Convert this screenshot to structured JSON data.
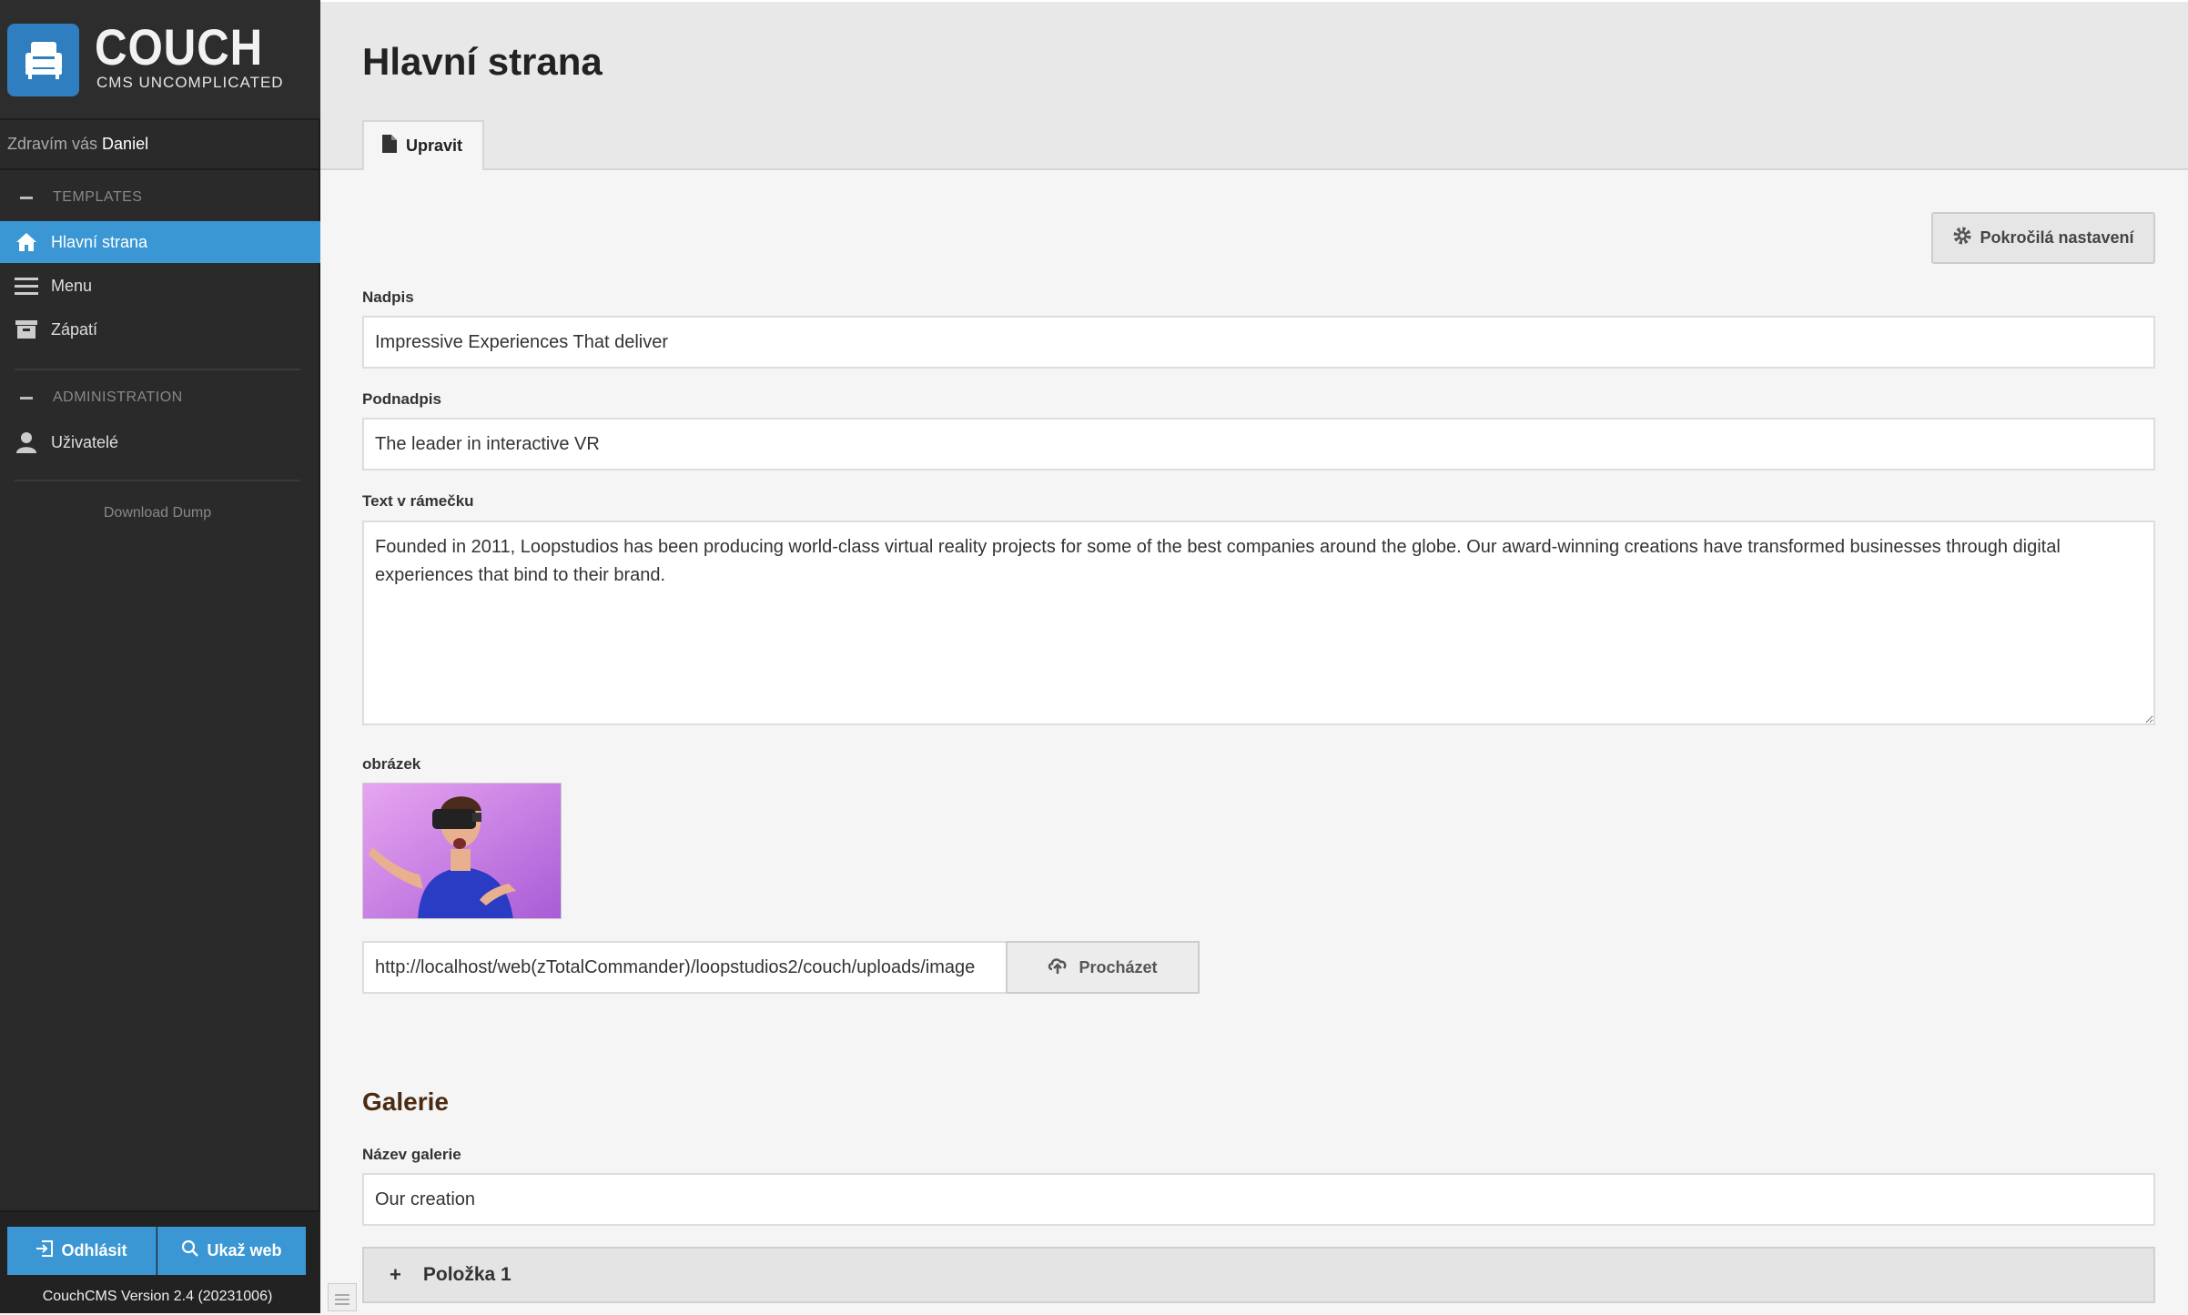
{
  "app": {
    "brand_name": "COUCH",
    "brand_tagline": "CMS UNCOMPLICATED",
    "greeting_prefix": "Zdravím vás",
    "user_name": "Daniel"
  },
  "sidebar": {
    "templates_heading": "TEMPLATES",
    "templates": [
      {
        "label": "Hlavní strana",
        "icon": "home-icon",
        "active": true
      },
      {
        "label": "Menu",
        "icon": "menu-icon",
        "active": false
      },
      {
        "label": "Zápatí",
        "icon": "archive-icon",
        "active": false
      }
    ],
    "admin_heading": "ADMINISTRATION",
    "admin_items": [
      {
        "label": "Uživatelé",
        "icon": "user-icon"
      }
    ],
    "download_dump": "Download Dump",
    "logout_label": "Odhlásit",
    "show_web_label": "Ukaž web",
    "version": "CouchCMS Version 2.4 (20231006)"
  },
  "main": {
    "page_title": "Hlavní strana",
    "tab_label": "Upravit",
    "advanced_button": "Pokročilá nastavení",
    "fields": {
      "nadpis_label": "Nadpis",
      "nadpis_value": "Impressive Experiences That deliver",
      "podnadpis_label": "Podnadpis",
      "podnadpis_value": "The leader in interactive VR",
      "text_label": "Text v rámečku",
      "text_value": "Founded in 2011, Loopstudios has been producing world-class virtual reality projects for some of the best companies around the globe. Our award-winning creations have transformed businesses through digital experiences that bind to their brand.",
      "image_label": "obrázek",
      "image_url": "http://localhost/web(zTotalCommander)/loopstudios2/couch/uploads/image",
      "browse_label": "Procházet"
    },
    "gallery": {
      "heading": "Galerie",
      "name_label": "Název galerie",
      "name_value": "Our creation",
      "item_label": "Položka 1"
    }
  },
  "colors": {
    "accent": "#3a97d4",
    "sidebar_bg": "#2a2a2a",
    "logo_bg": "#2f7fc0"
  }
}
